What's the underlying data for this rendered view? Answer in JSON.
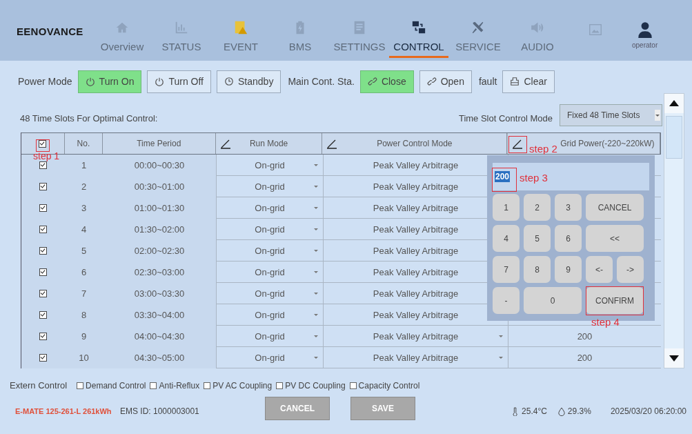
{
  "header": {
    "logo": "EENOVANCE",
    "nav": [
      {
        "label": "Overview",
        "selected": false
      },
      {
        "label": "STATUS",
        "selected": false
      },
      {
        "label": "EVENT",
        "selected": false
      },
      {
        "label": "BMS",
        "selected": false
      },
      {
        "label": "SETTINGS",
        "selected": false
      },
      {
        "label": "CONTROL",
        "selected": true
      },
      {
        "label": "SERVICE",
        "selected": false
      },
      {
        "label": "AUDIO",
        "selected": false
      }
    ],
    "user": "operator"
  },
  "toolbar": [
    {
      "kind": "label",
      "text": "Power Mode"
    },
    {
      "kind": "button",
      "text": "Turn On",
      "selected": true
    },
    {
      "kind": "button",
      "text": "Turn Off",
      "selected": false
    },
    {
      "kind": "button",
      "text": "Standby",
      "selected": false
    },
    {
      "kind": "label",
      "text": "Main Cont. Sta."
    },
    {
      "kind": "button",
      "text": "Close",
      "selected": true
    },
    {
      "kind": "button",
      "text": "Open",
      "selected": false
    },
    {
      "kind": "label",
      "text": "fault"
    },
    {
      "kind": "button",
      "text": "Clear",
      "selected": false
    }
  ],
  "section_title": "48 Time Slots For Optimal Control:",
  "mode_label": "Time Slot Control Mode",
  "mode_select": {
    "value": "Fixed 48 Time Slots"
  },
  "table": {
    "select_all": {
      "checked": true
    },
    "columns": [
      {
        "label": "No.",
        "editable": false
      },
      {
        "label": "Time Period",
        "editable": false
      },
      {
        "label": "Run Mode",
        "editable": true
      },
      {
        "label": "Power Control Mode",
        "editable": true
      },
      {
        "label": "Grid Power(-220~220kW)",
        "editable": true
      }
    ],
    "rows": [
      {
        "checked": true,
        "no": "1",
        "time": "00:00~00:30",
        "run_mode": "On-grid",
        "power_mode": "Peak Valley Arbitrage"
      },
      {
        "checked": true,
        "no": "2",
        "time": "00:30~01:00",
        "run_mode": "On-grid",
        "power_mode": "Peak Valley Arbitrage"
      },
      {
        "checked": true,
        "no": "3",
        "time": "01:00~01:30",
        "run_mode": "On-grid",
        "power_mode": "Peak Valley Arbitrage"
      },
      {
        "checked": true,
        "no": "4",
        "time": "01:30~02:00",
        "run_mode": "On-grid",
        "power_mode": "Peak Valley Arbitrage"
      },
      {
        "checked": true,
        "no": "5",
        "time": "02:00~02:30",
        "run_mode": "On-grid",
        "power_mode": "Peak Valley Arbitrage"
      },
      {
        "checked": true,
        "no": "6",
        "time": "02:30~03:00",
        "run_mode": "On-grid",
        "power_mode": "Peak Valley Arbitrage"
      },
      {
        "checked": true,
        "no": "7",
        "time": "03:00~03:30",
        "run_mode": "On-grid",
        "power_mode": "Peak Valley Arbitrage"
      },
      {
        "checked": true,
        "no": "8",
        "time": "03:30~04:00",
        "run_mode": "On-grid",
        "power_mode": "Peak Valley Arbitrage"
      },
      {
        "checked": true,
        "no": "9",
        "time": "04:00~04:30",
        "run_mode": "On-grid",
        "power_mode": "Peak Valley Arbitrage",
        "grid_power": "200"
      },
      {
        "checked": true,
        "no": "10",
        "time": "04:30~05:00",
        "run_mode": "On-grid",
        "power_mode": "Peak Valley Arbitrage",
        "grid_power": "200"
      }
    ]
  },
  "keypad": {
    "value": "200",
    "keys": [
      {
        "label": "1",
        "kind": "normal"
      },
      {
        "label": "2",
        "kind": "normal"
      },
      {
        "label": "3",
        "kind": "normal"
      },
      {
        "label": "CANCEL",
        "kind": "wide"
      },
      {
        "label": "4",
        "kind": "normal"
      },
      {
        "label": "5",
        "kind": "normal"
      },
      {
        "label": "6",
        "kind": "normal"
      },
      {
        "label": "<<",
        "kind": "wide"
      },
      {
        "label": "7",
        "kind": "normal"
      },
      {
        "label": "8",
        "kind": "normal"
      },
      {
        "label": "9",
        "kind": "normal"
      },
      {
        "label": "<-",
        "kind": "normal"
      },
      {
        "label": "->",
        "kind": "normal"
      },
      {
        "label": "-",
        "kind": "normal"
      },
      {
        "label": "0",
        "kind": "wide"
      },
      {
        "label": "CONFIRM",
        "kind": "wide"
      }
    ]
  },
  "annotations": [
    "step 1",
    "step 2",
    "step 3",
    "step 4"
  ],
  "extern_control": {
    "label": "Extern Control",
    "options": [
      {
        "label": "Demand Control",
        "checked": false
      },
      {
        "label": "Anti-Reflux",
        "checked": false
      },
      {
        "label": "PV AC Coupling",
        "checked": false
      },
      {
        "label": "PV DC Coupling",
        "checked": false
      },
      {
        "label": "Capacity Control",
        "checked": false
      }
    ]
  },
  "footer": {
    "model": "E-MATE 125-261-L 261kWh",
    "ems_id": "EMS ID: 1000003001",
    "buttons": [
      "CANCEL",
      "SAVE"
    ],
    "temperature": "25.4°C",
    "humidity": "29.3%",
    "datetime": "2025/03/20 06:20:00"
  }
}
